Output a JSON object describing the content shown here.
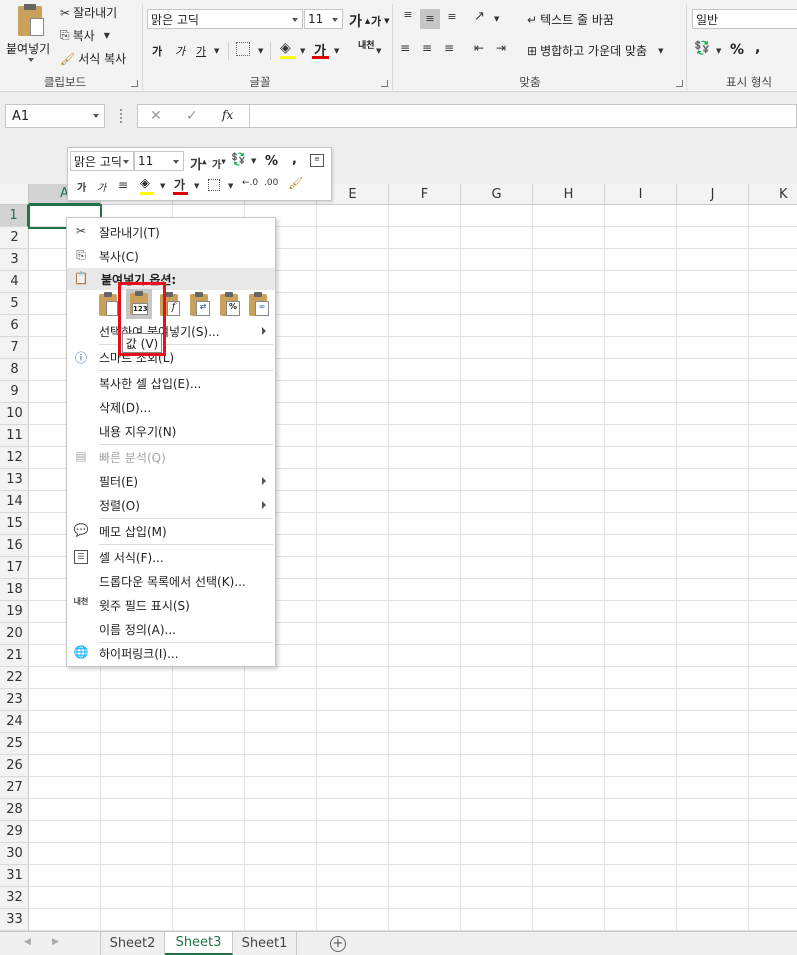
{
  "ribbon": {
    "clipboard": {
      "paste": "붙여넣기",
      "cut": "잘라내기",
      "copy": "복사",
      "format_painter": "서식 복사",
      "title": "클립보드"
    },
    "font": {
      "name": "맑은 고딕",
      "size": "11",
      "bold": "가",
      "italic": "가",
      "underline": "가",
      "font_color": "가",
      "title": "글꼴",
      "grow": "가",
      "shrink": "가",
      "phonetic": "내천"
    },
    "alignment": {
      "wrap": "텍스트 줄 바꿈",
      "merge": "병합하고 가운데 맞춤",
      "title": "맞춤"
    },
    "number": {
      "format": "일반",
      "percent": "%",
      "comma": ",",
      "title": "표시 형식"
    }
  },
  "formula_bar": {
    "name_box": "A1",
    "fx": "fx",
    "value": ""
  },
  "mini_toolbar": {
    "font": "맑은 고딕",
    "size": "11",
    "percent": "%",
    "comma": ","
  },
  "columns": [
    "A",
    "B",
    "C",
    "D",
    "E",
    "F",
    "G",
    "H",
    "I",
    "J",
    "K"
  ],
  "rows": [
    "1",
    "2",
    "3",
    "4",
    "5",
    "6",
    "7",
    "8",
    "9",
    "10",
    "11",
    "12",
    "13",
    "14",
    "15",
    "16",
    "17",
    "18",
    "19",
    "20",
    "21",
    "22",
    "23",
    "24",
    "25",
    "26",
    "27",
    "28",
    "29",
    "30",
    "31",
    "32",
    "33"
  ],
  "context_menu": {
    "cut": "잘라내기(T)",
    "copy": "복사(C)",
    "paste_options": "붙여넣기 옵션:",
    "paste_special": "선택하여 붙여넣기(S)...",
    "smart_lookup": "스마트 조회(L)",
    "insert_copied": "복사한 셀 삽입(E)...",
    "delete": "삭제(D)...",
    "clear": "내용 지우기(N)",
    "quick_analysis": "빠른 분석(Q)",
    "filter": "필터(E)",
    "sort": "정렬(O)",
    "insert_comment": "메모 삽입(M)",
    "format_cells": "셀 서식(F)...",
    "pick_list": "드롭다운 목록에서 선택(K)...",
    "phonetic": "윗주 필드 표시(S)",
    "define_name": "이름 정의(A)...",
    "hyperlink": "하이퍼링크(I)..."
  },
  "tooltip": "값 (V)",
  "values_icon_label": "123",
  "sheets": [
    "Sheet2",
    "Sheet3",
    "Sheet1"
  ],
  "active_sheet": "Sheet3",
  "colors": {
    "accent": "#217346",
    "highlight": "#e5101b",
    "font_underline": "#e00000"
  }
}
